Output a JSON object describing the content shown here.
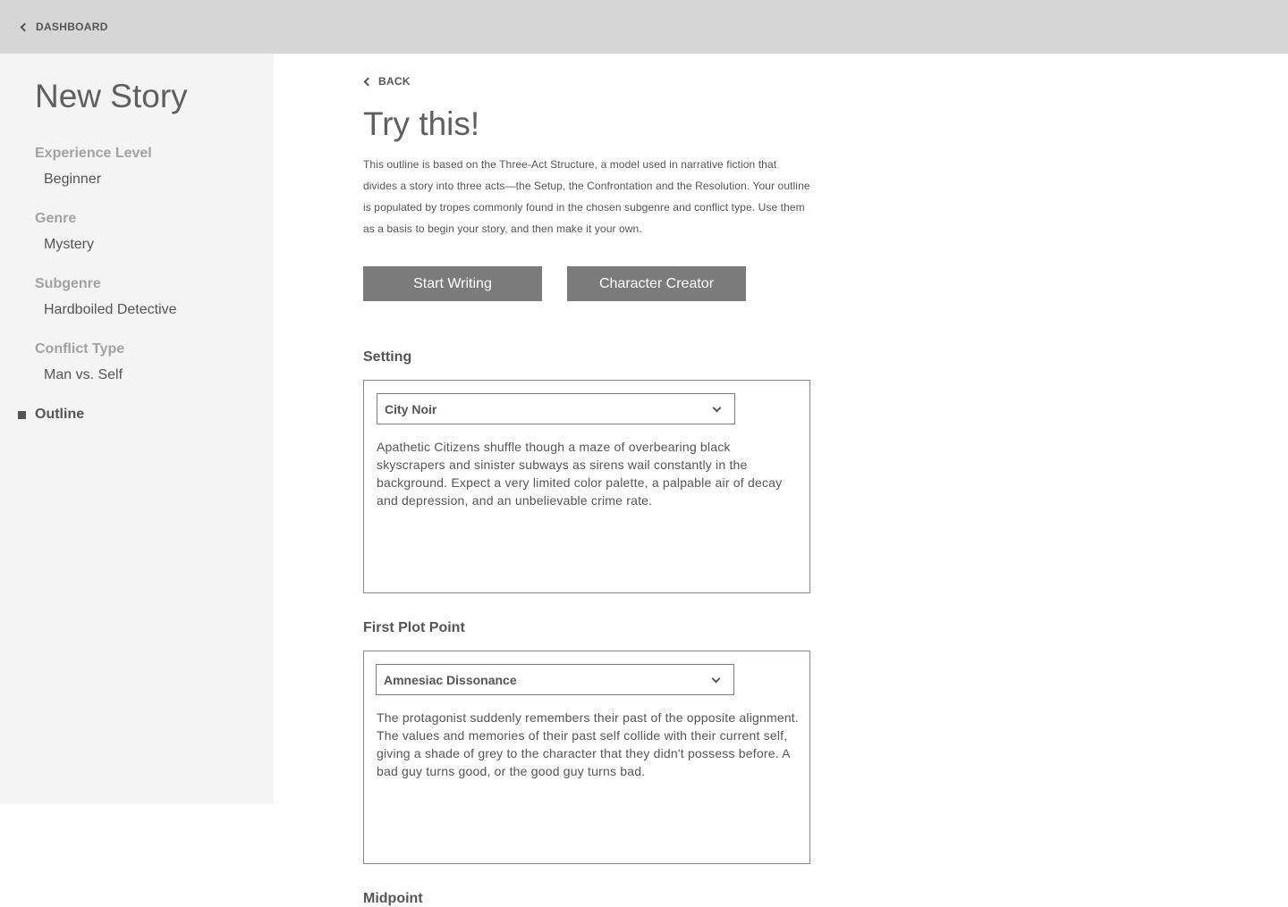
{
  "topbar": {
    "dashboard_label": "DASHBOARD"
  },
  "sidebar": {
    "title": "New Story",
    "sections": [
      {
        "label": "Experience Level",
        "value": "Beginner"
      },
      {
        "label": "Genre",
        "value": "Mystery"
      },
      {
        "label": "Subgenre",
        "value": "Hardboiled Detective"
      },
      {
        "label": "Conflict Type",
        "value": "Man vs. Self"
      }
    ],
    "active_item": "Outline"
  },
  "main": {
    "back_label": "BACK",
    "heading": "Try this!",
    "intro": "This outline is based on the Three-Act Structure, a model used in narrative fiction that divides a story into three acts—the Setup, the Confrontation and the Resolution. Your outline is populated by tropes commonly found in the chosen subgenre and conflict type. Use them as a basis to begin your story, and then make it your own.",
    "start_writing_label": "Start Writing",
    "character_creator_label": "Character Creator",
    "sections": [
      {
        "label": "Setting",
        "selected": "City Noir",
        "description": "Apathetic Citizens shuffle though a maze of overbearing black skyscrapers and sinister subways as sirens wail constantly in the background. Expect a very limited color palette, a palpable air of decay and depression, and an unbelievable crime rate."
      },
      {
        "label": "First Plot Point",
        "selected": "Amnesiac Dissonance",
        "description": "The protagonist suddenly remembers their past of the opposite alignment. The values and memories of their past self collide with their current self, giving a shade of grey to the character that they didn't possess before. A bad guy turns good, or the good guy turns bad."
      },
      {
        "label": "Midpoint"
      }
    ]
  },
  "icons": {
    "back": "chevron-left-icon",
    "dropdown": "chevron-down-icon",
    "active_bullet": "square-bullet-icon"
  }
}
